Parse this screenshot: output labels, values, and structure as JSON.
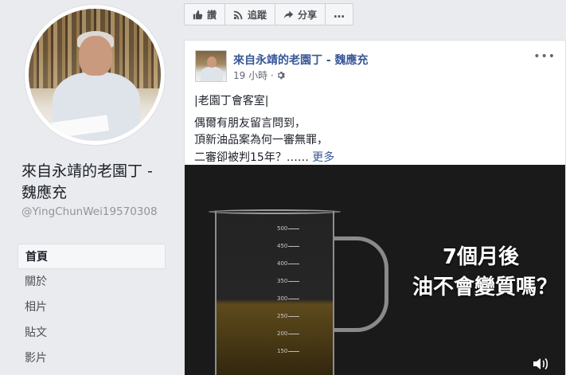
{
  "profile": {
    "name": "來自永靖的老園丁 - 魏應充",
    "handle": "@YingChunWei19570308"
  },
  "nav": {
    "items": [
      {
        "label": "首頁",
        "active": true
      },
      {
        "label": "關於",
        "active": false
      },
      {
        "label": "相片",
        "active": false
      },
      {
        "label": "貼文",
        "active": false
      },
      {
        "label": "影片",
        "active": false
      }
    ]
  },
  "actions": {
    "like_label": "讚",
    "follow_label": "追蹤",
    "share_label": "分享",
    "more_label": "…",
    "icons": [
      "thumbs-up-icon",
      "rss-icon",
      "share-arrow-icon",
      "ellipsis-icon"
    ]
  },
  "post": {
    "author": "來自永靖的老園丁 - 魏應充",
    "time": "19 小時 ·",
    "text_lines": [
      "|老園丁會客室|",
      "偶爾有朋友留言問到，",
      "頂新油品案為何一審無罪，",
      "二審卻被判15年？……"
    ],
    "see_more": "更多",
    "menu": "•••",
    "video": {
      "caption_line1": "7個月後",
      "caption_line2": "油不會變質嗎？",
      "beaker_marks": [
        "500",
        "450",
        "400",
        "350",
        "300",
        "250",
        "200",
        "150"
      ]
    }
  },
  "colors": {
    "link": "#385898",
    "background": "#e9ebee",
    "text": "#1d2129"
  }
}
